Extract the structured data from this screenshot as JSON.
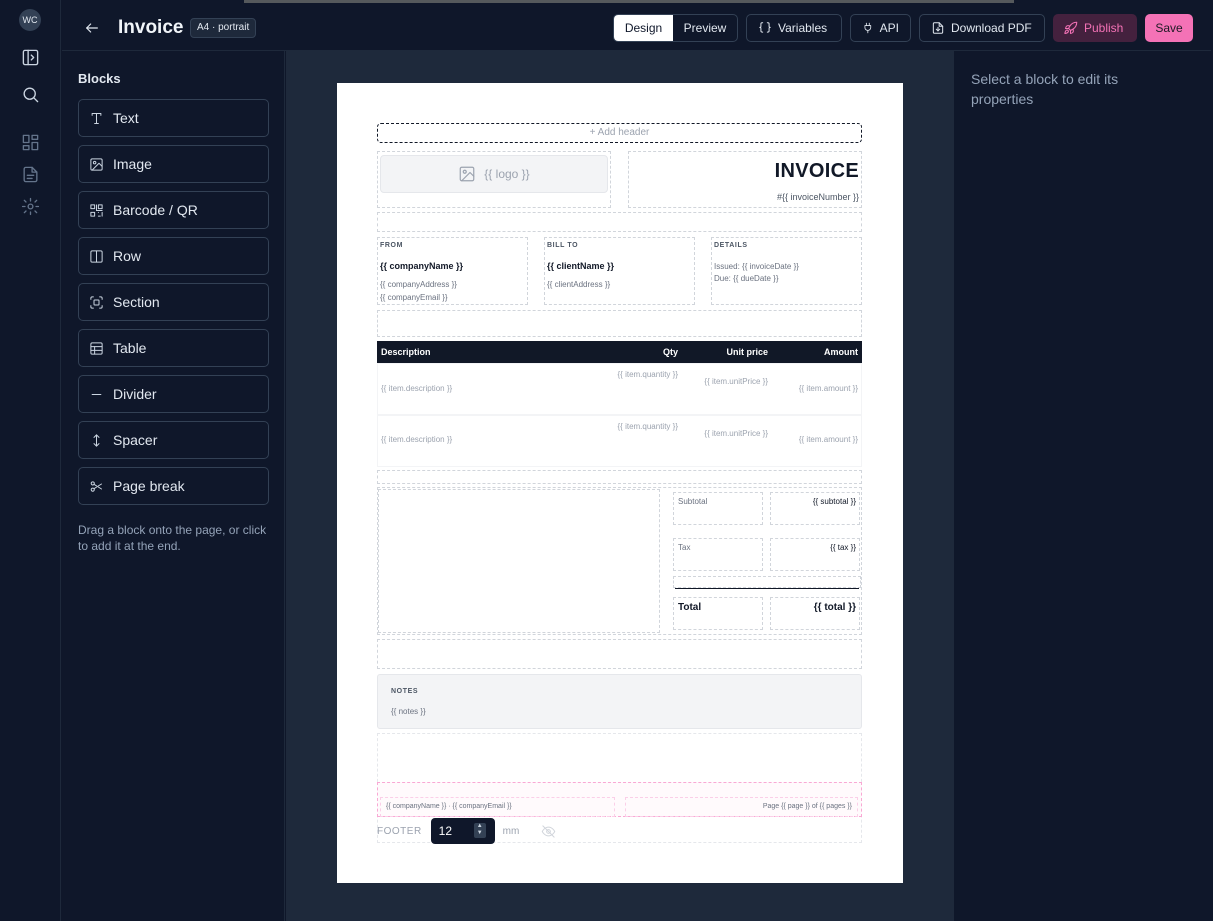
{
  "rail": {
    "avatar": "WC",
    "icons": [
      "sidebar-toggle-icon",
      "search-icon",
      "dashboard-icon",
      "document-icon",
      "gear-icon"
    ]
  },
  "header": {
    "title": "Invoice",
    "badge": "A4 · portrait",
    "mode_design": "Design",
    "mode_preview": "Preview",
    "variables": "Variables",
    "api": "API",
    "download": "Download PDF",
    "publish": "Publish",
    "save": "Save"
  },
  "blocks": {
    "title": "Blocks",
    "items": [
      {
        "label": "Text",
        "icon": "text-icon"
      },
      {
        "label": "Image",
        "icon": "image-icon"
      },
      {
        "label": "Barcode / QR",
        "icon": "qr-icon"
      },
      {
        "label": "Row",
        "icon": "row-icon"
      },
      {
        "label": "Section",
        "icon": "section-icon"
      },
      {
        "label": "Table",
        "icon": "table-icon"
      },
      {
        "label": "Divider",
        "icon": "divider-icon"
      },
      {
        "label": "Spacer",
        "icon": "spacer-icon"
      },
      {
        "label": "Page break",
        "icon": "page-break-icon"
      }
    ],
    "hint": "Drag a block onto the page, or click to add it at the end."
  },
  "properties": {
    "empty": "Select a block to edit its properties"
  },
  "page": {
    "add_header": "+ Add header",
    "logo": "{{ logo }}",
    "invoice_title": "INVOICE",
    "invoice_number": "#{{ invoiceNumber }}",
    "from": {
      "label": "FROM",
      "name": "{{ companyName }}",
      "address": "{{ companyAddress }}",
      "email": "{{ companyEmail }}"
    },
    "bill_to": {
      "label": "BILL TO",
      "name": "{{ clientName }}",
      "address": "{{ clientAddress }}"
    },
    "details": {
      "label": "DETAILS",
      "issued": "Issued: {{ invoiceDate }}",
      "due": "Due: {{ dueDate }}"
    },
    "table": {
      "columns": [
        "Description",
        "Qty",
        "Unit price",
        "Amount"
      ],
      "rows": [
        {
          "description": "{{ item.description }}",
          "qty": "{{ item.quantity }}",
          "unit_price": "{{ item.unitPrice }}",
          "amount": "{{ item.amount }}"
        },
        {
          "description": "{{ item.description }}",
          "qty": "{{ item.quantity }}",
          "unit_price": "{{ item.unitPrice }}",
          "amount": "{{ item.amount }}"
        }
      ]
    },
    "summary": {
      "subtotal_label": "Subtotal",
      "subtotal_value": "{{ subtotal }}",
      "tax_label": "Tax",
      "tax_value": "{{ tax }}",
      "total_label": "Total",
      "total_value": "{{ total }}"
    },
    "notes": {
      "label": "NOTES",
      "value": "{{ notes }}"
    },
    "footer": {
      "left": "{{ companyName }} · {{ companyEmail }}",
      "right": "Page {{ page }} of {{ pages }}",
      "label": "FOOTER",
      "height": "12",
      "unit": "mm"
    }
  },
  "colors": {
    "accent": "#f472b6",
    "background": "#0f172a",
    "canvas": "#1e293b"
  }
}
